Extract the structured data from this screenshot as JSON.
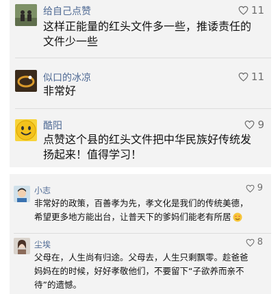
{
  "comments_top": [
    {
      "author": "给自己点赞",
      "likes": "11",
      "lines": [
        "这样正能量的红头文件多一些，推诿责任的",
        "文件少一些"
      ],
      "avatar": "avatar-couple"
    },
    {
      "author": "似口的冰凉",
      "likes": "11",
      "lines": [
        "非常好"
      ],
      "avatar": "avatar-ring"
    },
    {
      "author": "酷阳",
      "likes": "9",
      "lines": [
        "点赞这个县的红头文件把中华民族好传统发",
        "扬起来！值得学习！"
      ],
      "avatar": "avatar-smiley"
    }
  ],
  "comments_bottom": [
    {
      "author": "小志",
      "likes": "9",
      "lines": [
        "非常好的政策，百善孝为先，孝文化是我们的传统美德，",
        "希望更多地方能出台，让普天下的爹妈们能老有所居"
      ],
      "avatar": "avatar-cartoon-boy"
    },
    {
      "author": "尘埃",
      "likes": "8",
      "lines": [
        "父母在，人生尚有归途。父母去，人生只剩飘零。趁爸爸",
        "妈妈在的时候，好好孝敬他们，不要留下“子欲养而亲不",
        "待”的遗憾。"
      ],
      "avatar": "avatar-woman"
    }
  ],
  "colors": {
    "name": "#4f6a94",
    "panel_bg": "#f3f3f3",
    "likes": "#6e6e6e"
  }
}
